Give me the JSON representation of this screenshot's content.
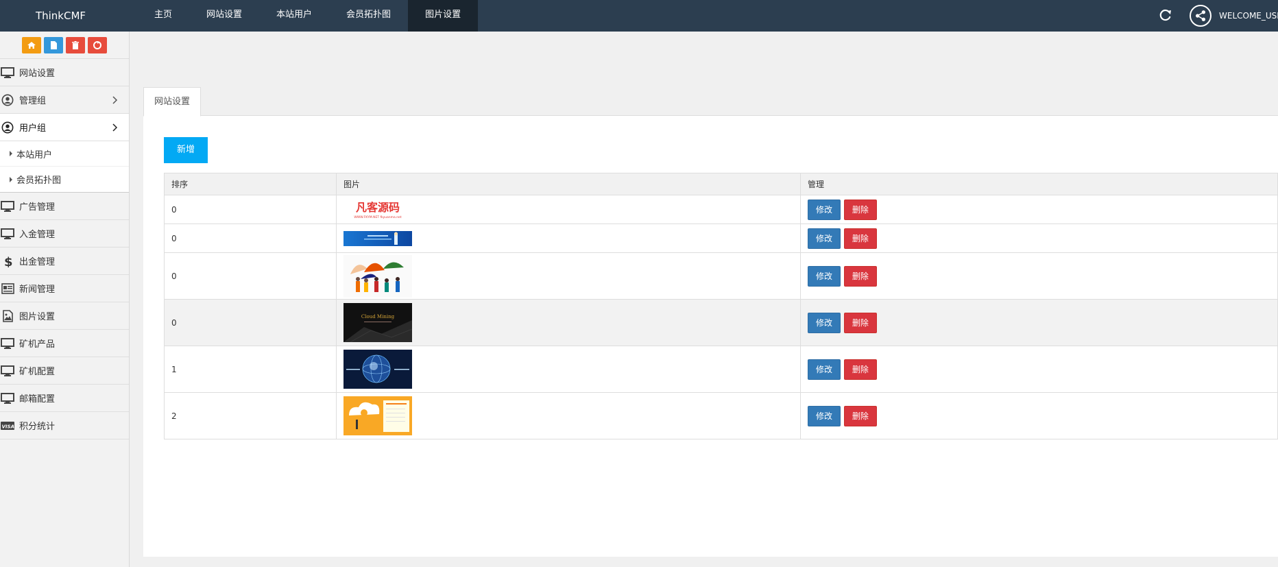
{
  "navbar": {
    "brand": "ThinkCMF",
    "items": [
      {
        "label": "主页"
      },
      {
        "label": "网站设置"
      },
      {
        "label": "本站用户"
      },
      {
        "label": "会员拓扑图"
      },
      {
        "label": "图片设置"
      }
    ],
    "active_index": 4,
    "welcome": "WELCOME_USER"
  },
  "sidebar": {
    "shortcuts": [
      {
        "icon": "home-icon",
        "color": "#f39c12"
      },
      {
        "icon": "file-icon",
        "color": "#3498db"
      },
      {
        "icon": "trash-icon",
        "color": "#e74c3c"
      },
      {
        "icon": "recycle-icon",
        "color": "#e74c3c"
      }
    ],
    "items": [
      {
        "label": "网站设置",
        "icon": "desktop-icon"
      },
      {
        "label": "管理组",
        "icon": "user-circle-icon",
        "chevron": true
      },
      {
        "label": "用户组",
        "icon": "user-circle-icon",
        "chevron": true,
        "expanded": true
      }
    ],
    "submenu": [
      {
        "label": "本站用户"
      },
      {
        "label": "会员拓扑图"
      }
    ],
    "items2": [
      {
        "label": "广告管理",
        "icon": "desktop-icon"
      },
      {
        "label": "入金管理",
        "icon": "desktop-icon"
      },
      {
        "label": "出金管理",
        "icon": "dollar-icon"
      },
      {
        "label": "新闻管理",
        "icon": "newspaper-icon"
      },
      {
        "label": "图片设置",
        "icon": "image-icon"
      },
      {
        "label": "矿机产品",
        "icon": "desktop-icon"
      },
      {
        "label": "矿机配置",
        "icon": "desktop-icon"
      },
      {
        "label": "邮箱配置",
        "icon": "desktop-icon"
      },
      {
        "label": "积分统计",
        "icon": "visa-icon"
      }
    ]
  },
  "content": {
    "tab": "网站设置",
    "add_button": "新增",
    "columns": [
      "排序",
      "图片",
      "管理"
    ],
    "rows": [
      {
        "order": "0",
        "image": "banner-fanke",
        "edit": "修改",
        "delete": "删除"
      },
      {
        "order": "0",
        "image": "banner-blue",
        "edit": "修改",
        "delete": "删除"
      },
      {
        "order": "0",
        "image": "banner-people",
        "edit": "修改",
        "delete": "删除"
      },
      {
        "order": "0",
        "image": "banner-cloud-mining",
        "edit": "修改",
        "delete": "删除"
      },
      {
        "order": "1",
        "image": "banner-globe",
        "edit": "修改",
        "delete": "删除"
      },
      {
        "order": "2",
        "image": "banner-yellow",
        "edit": "修改",
        "delete": "删除"
      }
    ],
    "thumb_text": {
      "fanke": "凡客源码",
      "fanke_sub": "WWW.FKYM.NET  fkyuanma.net",
      "cloud": "Cloud Mining"
    }
  }
}
